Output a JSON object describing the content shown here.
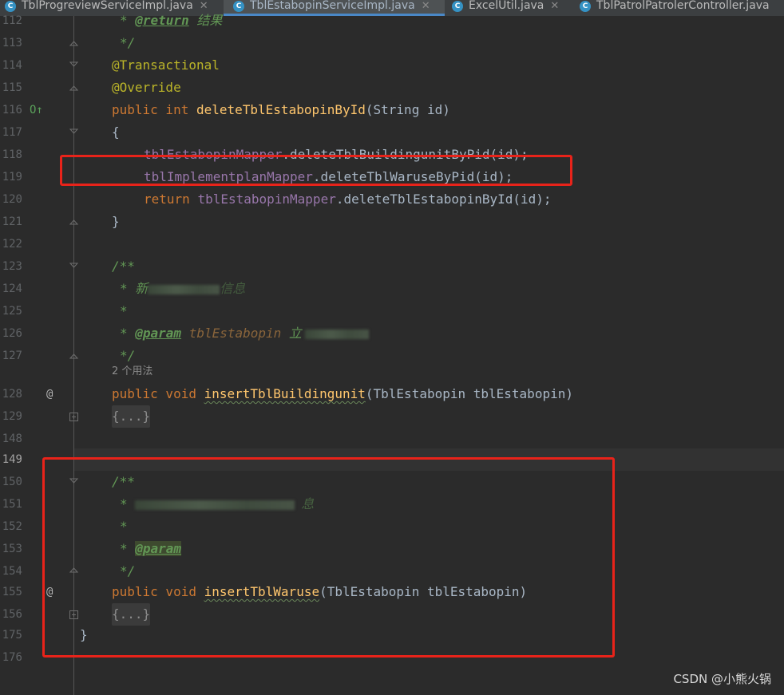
{
  "tabs": [
    {
      "label": "TblProgreviewServiceImpl.java",
      "icon": "java-class-icon",
      "active": false
    },
    {
      "label": "TblEstabopinServiceImpl.java",
      "icon": "java-class-icon",
      "active": true
    },
    {
      "label": "ExcelUtil.java",
      "icon": "java-class-icon",
      "active": false
    },
    {
      "label": "TblPatrolPatrolerController.java",
      "icon": "java-class-icon",
      "active": false
    }
  ],
  "line_numbers": [
    "112",
    "113",
    "114",
    "115",
    "116",
    "117",
    "118",
    "119",
    "120",
    "121",
    "122",
    "123",
    "124",
    "125",
    "126",
    "127",
    "128",
    "129",
    "148",
    "149",
    "150",
    "151",
    "152",
    "153",
    "154",
    "155",
    "156",
    "175",
    "176"
  ],
  "code": {
    "l112_tag": "@return",
    "l112_text": " 结果",
    "l113": "*/",
    "l114": "@Transactional",
    "l115": "@Override",
    "l116_kw": "public int ",
    "l116_fn": "deleteTblEstabopinById",
    "l116_rest": "(String id)",
    "l117": "{",
    "l118_field": "tblEstabopinMapper",
    "l118_rest": ".deleteTblBuildingunitByPid(id);",
    "l119_field": "tblImplementplanMapper",
    "l119_rest": ".deleteTblWaruseByPid(id);",
    "l120_kw": "return ",
    "l120_field": "tblEstabopinMapper",
    "l120_rest": ".deleteTblEstabopinById(id);",
    "l121": "}",
    "l123": "/**",
    "l124_a": "* 新",
    "l124_b": "信息",
    "l125": "*",
    "l126_star": "* ",
    "l126_tag": "@param",
    "l126_param": " tblEstabopin ",
    "l126_text": "立",
    "l127": "*/",
    "usage_hint": "2 个用法",
    "l128_kw": "public void ",
    "l128_fn": "insertTblBuildingunit",
    "l128_rest": "(TblEstabopin tblEstabopin)",
    "l129": "{...}",
    "l150": "/**",
    "l151_a": "* ",
    "l151_b": "息",
    "l152": "*",
    "l153_star": "* ",
    "l153_tag": "@param",
    "l154": "*/",
    "l155_kw": "public void ",
    "l155_fn": "insertTblWaruse",
    "l155_rest": "(TblEstabopin tblEstabopin)",
    "l156": "{...}",
    "l175": "}"
  },
  "gutter": {
    "override_icon_label": "O↑",
    "implementing_icon_label": "@"
  },
  "watermark": "CSDN @小熊火锅",
  "colors": {
    "annotation_box": "#e8231a",
    "keyword": "#cc7832",
    "function": "#ffc66d",
    "field": "#9876aa",
    "doc_comment": "#629755"
  }
}
